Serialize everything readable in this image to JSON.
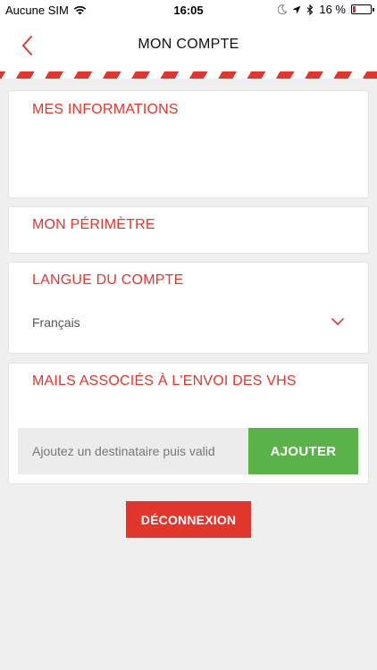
{
  "status_bar": {
    "carrier": "Aucune SIM",
    "time": "16:05",
    "battery": "16 %",
    "battery_level": 0.16
  },
  "header": {
    "title": "MON COMPTE",
    "back_icon": "chevron-left-icon"
  },
  "sections": {
    "informations": {
      "title": "MES INFORMATIONS"
    },
    "perimetre": {
      "title": "MON PÉRIMÈTRE"
    },
    "langue": {
      "title": "LANGUE DU COMPTE",
      "selected": "Français"
    },
    "mails": {
      "title": "MAILS ASSOCIÉS À L'ENVOI DES VHS",
      "input_placeholder": "Ajoutez un destinataire puis valid",
      "add_label": "AJOUTER"
    }
  },
  "logout_label": "DÉCONNEXION",
  "colors": {
    "accent": "#e2352b",
    "success": "#5bb248",
    "background": "#efefef"
  }
}
